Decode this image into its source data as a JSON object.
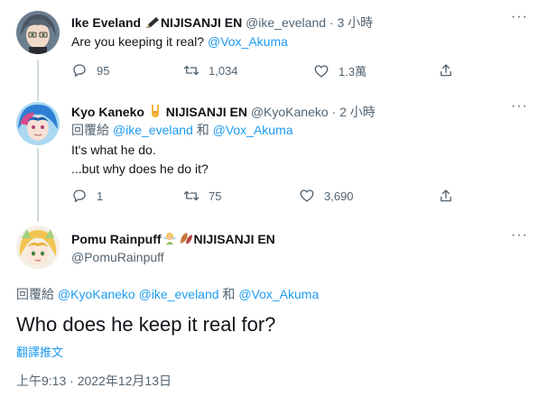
{
  "tweets": [
    {
      "name": "Ike Eveland",
      "org": "NIJISANJI EN",
      "handle": "@ike_eveland",
      "dot": "·",
      "time": "3 小時",
      "text_prefix": "Are you keeping it real? ",
      "text_mention": "@Vox_Akuma",
      "stats": {
        "replies": "95",
        "retweets": "1,034",
        "likes": "1.3萬"
      },
      "icons": [
        "pen-emoji"
      ]
    },
    {
      "name": "Kyo Kaneko",
      "org": "NIJISANJI EN",
      "handle": "@KyoKaneko",
      "dot": "·",
      "time": "2 小時",
      "reply_label": "回覆給 ",
      "reply_mention_1": "@ike_eveland",
      "reply_joiner": " 和 ",
      "reply_mention_2": "@Vox_Akuma",
      "line1": "It's what he do.",
      "line2": "...but why does he do it?",
      "stats": {
        "replies": "1",
        "retweets": "75",
        "likes": "3,690"
      },
      "icons": [
        "rock-hand-emoji"
      ]
    }
  ],
  "main": {
    "name": "Pomu Rainpuff",
    "org": "NIJISANJI EN",
    "handle": "@PomuRainpuff",
    "reply_label": "回覆給 ",
    "reply_mention_1": "@KyoKaneko",
    "reply_mention_2": "@ike_eveland",
    "reply_joiner": " 和 ",
    "reply_mention_3": "@Vox_Akuma",
    "text": "Who does he keep it real for?",
    "translate": "翻譯推文",
    "timestamp": "上午9:13 · 2022年12月13日",
    "icons": [
      "fairy-emoji",
      "leaf-emoji"
    ]
  },
  "colors": {
    "accent": "#1d9bf0",
    "muted": "#536471",
    "line": "#cfd9de"
  }
}
